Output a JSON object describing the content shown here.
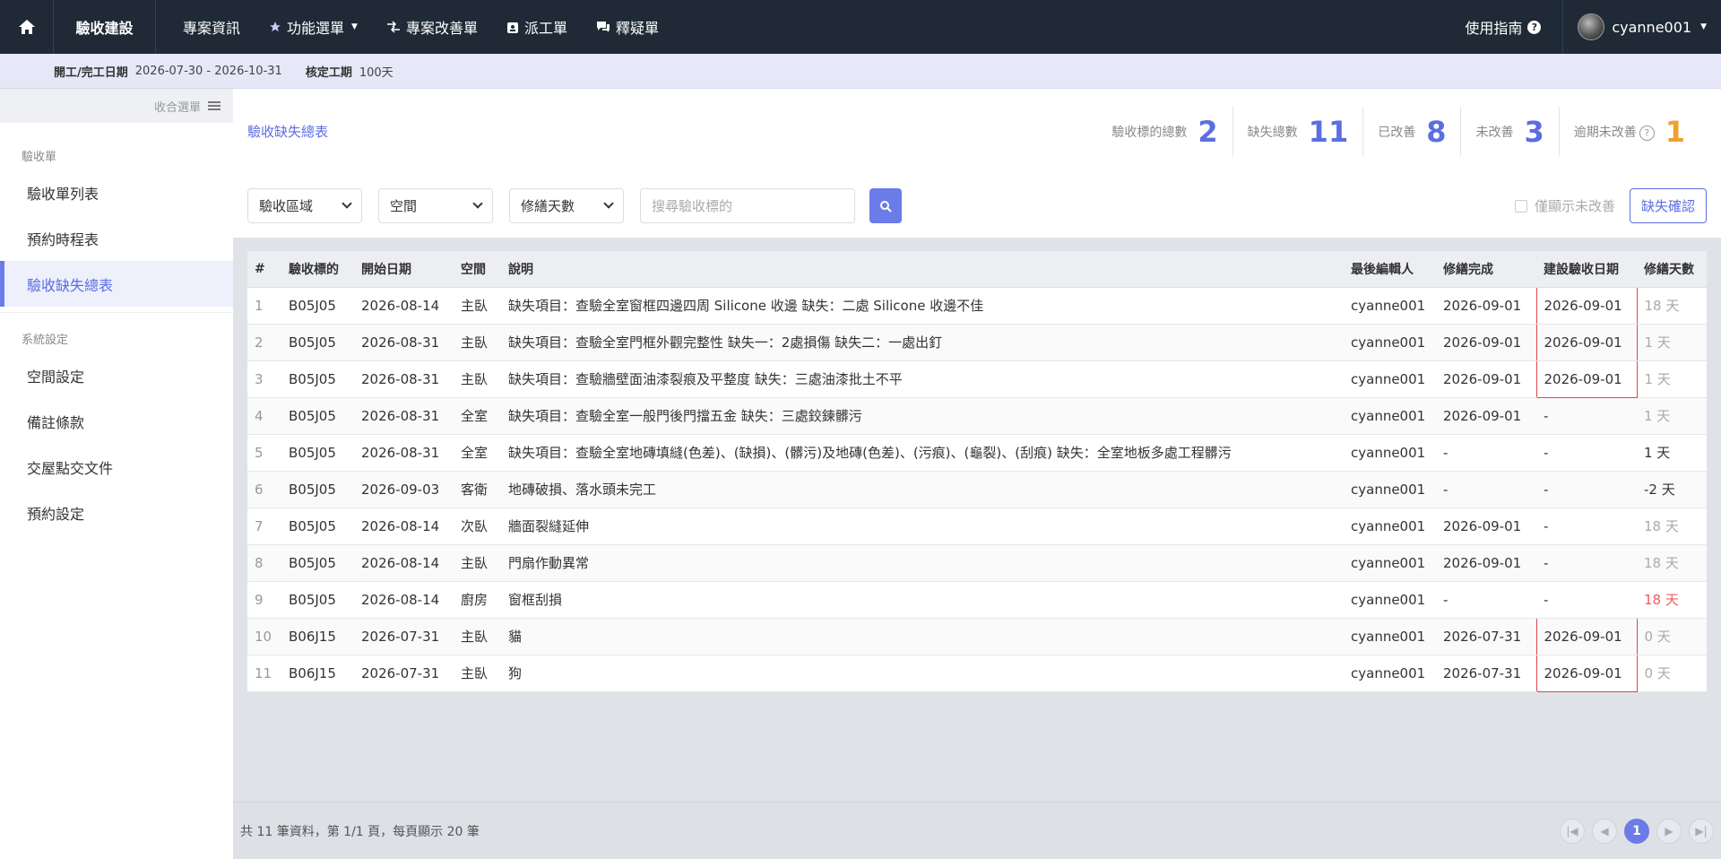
{
  "topbar": {
    "brand": "驗收建設",
    "nav": [
      {
        "label": "專案資訊",
        "icon": ""
      },
      {
        "label": "功能選單",
        "icon": "star-icon"
      },
      {
        "label": "專案改善單",
        "icon": "swap-check-icon"
      },
      {
        "label": "派工單",
        "icon": "badge-icon"
      },
      {
        "label": "釋疑單",
        "icon": "chat-icon"
      }
    ],
    "guide_label": "使用指南",
    "username": "cyanne001"
  },
  "infobar": {
    "date_label": "開工/完工日期",
    "date_value": "2026-07-30 - 2026-10-31",
    "duration_label": "核定工期",
    "duration_value": "100天"
  },
  "sidebar": {
    "collapse_label": "收合選單",
    "groups": [
      {
        "title": "驗收單",
        "items": [
          "驗收單列表",
          "預約時程表",
          "驗收缺失總表"
        ]
      },
      {
        "title": "系統設定",
        "items": [
          "空間設定",
          "備註條款",
          "交屋點交文件",
          "預約設定"
        ]
      }
    ],
    "active": "驗收缺失總表"
  },
  "summary": {
    "title": "驗收缺失總表",
    "stats": [
      {
        "label": "驗收標的總數",
        "value": "2"
      },
      {
        "label": "缺失總數",
        "value": "11"
      },
      {
        "label": "已改善",
        "value": "8"
      },
      {
        "label": "未改善",
        "value": "3"
      },
      {
        "label": "逾期未改善",
        "value": "1"
      }
    ]
  },
  "filters": {
    "area": "驗收區域",
    "space": "空間",
    "repair_days": "修繕天數",
    "search_placeholder": "搜尋驗收標的",
    "only_unimproved": "僅顯示未改善",
    "confirm_button": "缺失確認"
  },
  "table": {
    "headers": [
      "#",
      "驗收標的",
      "開始日期",
      "空間",
      "說明",
      "最後編輯人",
      "修繕完成",
      "建設驗收日期",
      "修繕天數"
    ],
    "rows": [
      [
        "1",
        "B05J05",
        "2026-08-14",
        "主臥",
        "缺失項目：查驗全室窗框四邊四周 Silicone 收邊 缺失：二處 Silicone 收邊不佳",
        "cyanne001",
        "2026-09-01",
        "2026-09-01",
        "18 天"
      ],
      [
        "2",
        "B05J05",
        "2026-08-31",
        "主臥",
        "缺失項目：查驗全室門框外觀完整性 缺失一：2處損傷 缺失二：一處出釘",
        "cyanne001",
        "2026-09-01",
        "2026-09-01",
        "1 天"
      ],
      [
        "3",
        "B05J05",
        "2026-08-31",
        "主臥",
        "缺失項目：查驗牆壁面油漆裂痕及平整度 缺失：三處油漆批土不平",
        "cyanne001",
        "2026-09-01",
        "2026-09-01",
        "1 天"
      ],
      [
        "4",
        "B05J05",
        "2026-08-31",
        "全室",
        "缺失項目：查驗全室一般門後門擋五金 缺失：三處鉸鍊髒污",
        "cyanne001",
        "2026-09-01",
        "-",
        "1 天"
      ],
      [
        "5",
        "B05J05",
        "2026-08-31",
        "全室",
        "缺失項目：查驗全室地磚填縫(色差)、(缺損)、(髒污)及地磚(色差)、(污痕)、(龜裂)、(刮痕) 缺失：全室地板多處工程髒污",
        "cyanne001",
        "-",
        "-",
        "1 天"
      ],
      [
        "6",
        "B05J05",
        "2026-09-03",
        "客衛",
        "地磚破損、落水頭未完工",
        "cyanne001",
        "-",
        "-",
        "-2 天"
      ],
      [
        "7",
        "B05J05",
        "2026-08-14",
        "次臥",
        "牆面裂縫延伸",
        "cyanne001",
        "2026-09-01",
        "-",
        "18 天"
      ],
      [
        "8",
        "B05J05",
        "2026-08-14",
        "主臥",
        "門扇作動異常",
        "cyanne001",
        "2026-09-01",
        "-",
        "18 天"
      ],
      [
        "9",
        "B05J05",
        "2026-08-14",
        "廚房",
        "窗框刮損",
        "cyanne001",
        "-",
        "-",
        "18 天"
      ],
      [
        "10",
        "B06J15",
        "2026-07-31",
        "主臥",
        "貓",
        "cyanne001",
        "2026-07-31",
        "2026-09-01",
        "0 天"
      ],
      [
        "11",
        "B06J15",
        "2026-07-31",
        "主臥",
        "狗",
        "cyanne001",
        "2026-07-31",
        "2026-09-01",
        "0 天"
      ]
    ]
  },
  "footer": {
    "summary": "共 11 筆資料，第 1/1 頁，每頁顯示 20 筆",
    "current_page": "1"
  },
  "colors": {
    "accent": "#5b6ee1",
    "overdue": "#f15a5a",
    "highlight_box": "#e04646",
    "topbar": "#1f2a36"
  }
}
